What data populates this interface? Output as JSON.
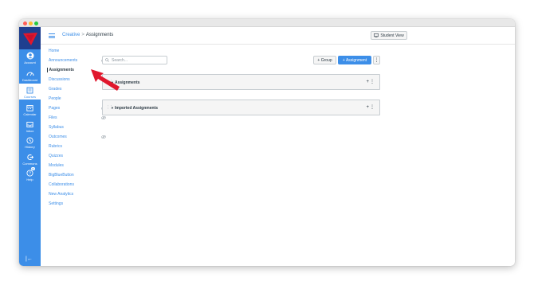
{
  "global_nav": {
    "items": [
      {
        "label": "Account",
        "icon": "account-icon"
      },
      {
        "label": "Dashboard",
        "icon": "dashboard-icon"
      },
      {
        "label": "Courses",
        "icon": "courses-icon"
      },
      {
        "label": "Calendar",
        "icon": "calendar-icon"
      },
      {
        "label": "Inbox",
        "icon": "inbox-icon"
      },
      {
        "label": "History",
        "icon": "history-icon"
      },
      {
        "label": "Commons",
        "icon": "commons-icon"
      },
      {
        "label": "Help",
        "icon": "help-icon",
        "badge": "10"
      }
    ],
    "collapse": "|←",
    "colors": {
      "nav_bg": "#3c8ee8",
      "logo_bg": "#1f3f8f",
      "logo_red": "#e0182d"
    }
  },
  "header": {
    "breadcrumb": {
      "course": "Creative",
      "separator": ">",
      "page": "Assignments"
    },
    "student_view": "Student View"
  },
  "course_nav": {
    "items": [
      {
        "label": "Home"
      },
      {
        "label": "Announcements",
        "hidden": true
      },
      {
        "label": "Assignments",
        "active": true
      },
      {
        "label": "Discussions"
      },
      {
        "label": "Grades"
      },
      {
        "label": "People"
      },
      {
        "label": "Pages",
        "hidden": true
      },
      {
        "label": "Files",
        "hidden": true
      },
      {
        "label": "Syllabus"
      },
      {
        "label": "Outcomes",
        "hidden": true
      },
      {
        "label": "Rubrics"
      },
      {
        "label": "Quizzes"
      },
      {
        "label": "Modules"
      },
      {
        "label": "BigBlueButton"
      },
      {
        "label": "Collaborations"
      },
      {
        "label": "New Analytics"
      },
      {
        "label": "Settings"
      }
    ]
  },
  "toolbar": {
    "search_placeholder": "Search...",
    "group_button": "+ Group",
    "assignment_button": "+ Assignment",
    "more": "⋮"
  },
  "assignment_groups": [
    {
      "title": "Assignments"
    },
    {
      "title": "Imported Assignments"
    }
  ],
  "annotation": {
    "color": "#e0182d"
  }
}
